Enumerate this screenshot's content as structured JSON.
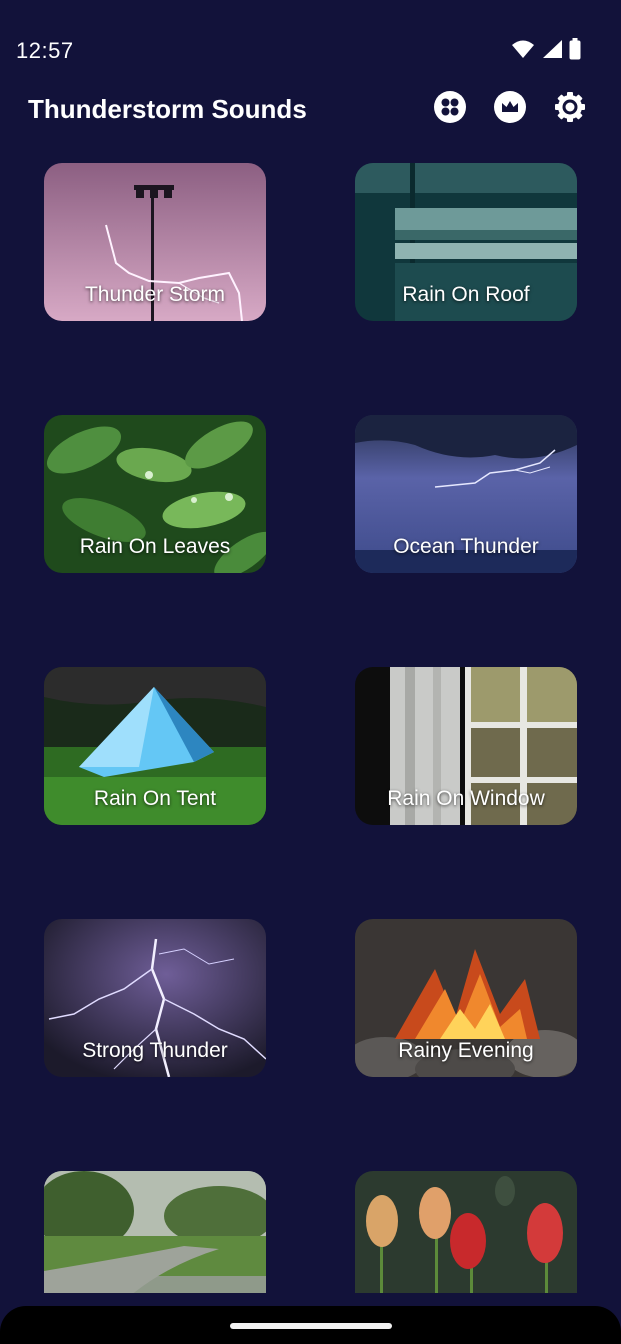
{
  "status_bar": {
    "time": "12:57"
  },
  "app_bar": {
    "title": "Thunderstorm Sounds",
    "actions": [
      "grid-icon",
      "crown-icon",
      "settings-icon"
    ]
  },
  "sounds": [
    {
      "label": "Thunder Storm",
      "theme": "lightning-pink"
    },
    {
      "label": "Rain On Roof",
      "theme": "roof-teal"
    },
    {
      "label": "Rain On Leaves",
      "theme": "leaves-green"
    },
    {
      "label": "Ocean Thunder",
      "theme": "ocean-purple"
    },
    {
      "label": "Rain On Tent",
      "theme": "tent-night"
    },
    {
      "label": "Rain On Window",
      "theme": "window-dark"
    },
    {
      "label": "Strong Thunder",
      "theme": "lightning-violet"
    },
    {
      "label": "Rainy Evening",
      "theme": "campfire"
    },
    {
      "label": "",
      "theme": "road-green"
    },
    {
      "label": "",
      "theme": "tulips"
    }
  ],
  "colors": {
    "background": "#12123a",
    "nav_bar": "#000000"
  }
}
